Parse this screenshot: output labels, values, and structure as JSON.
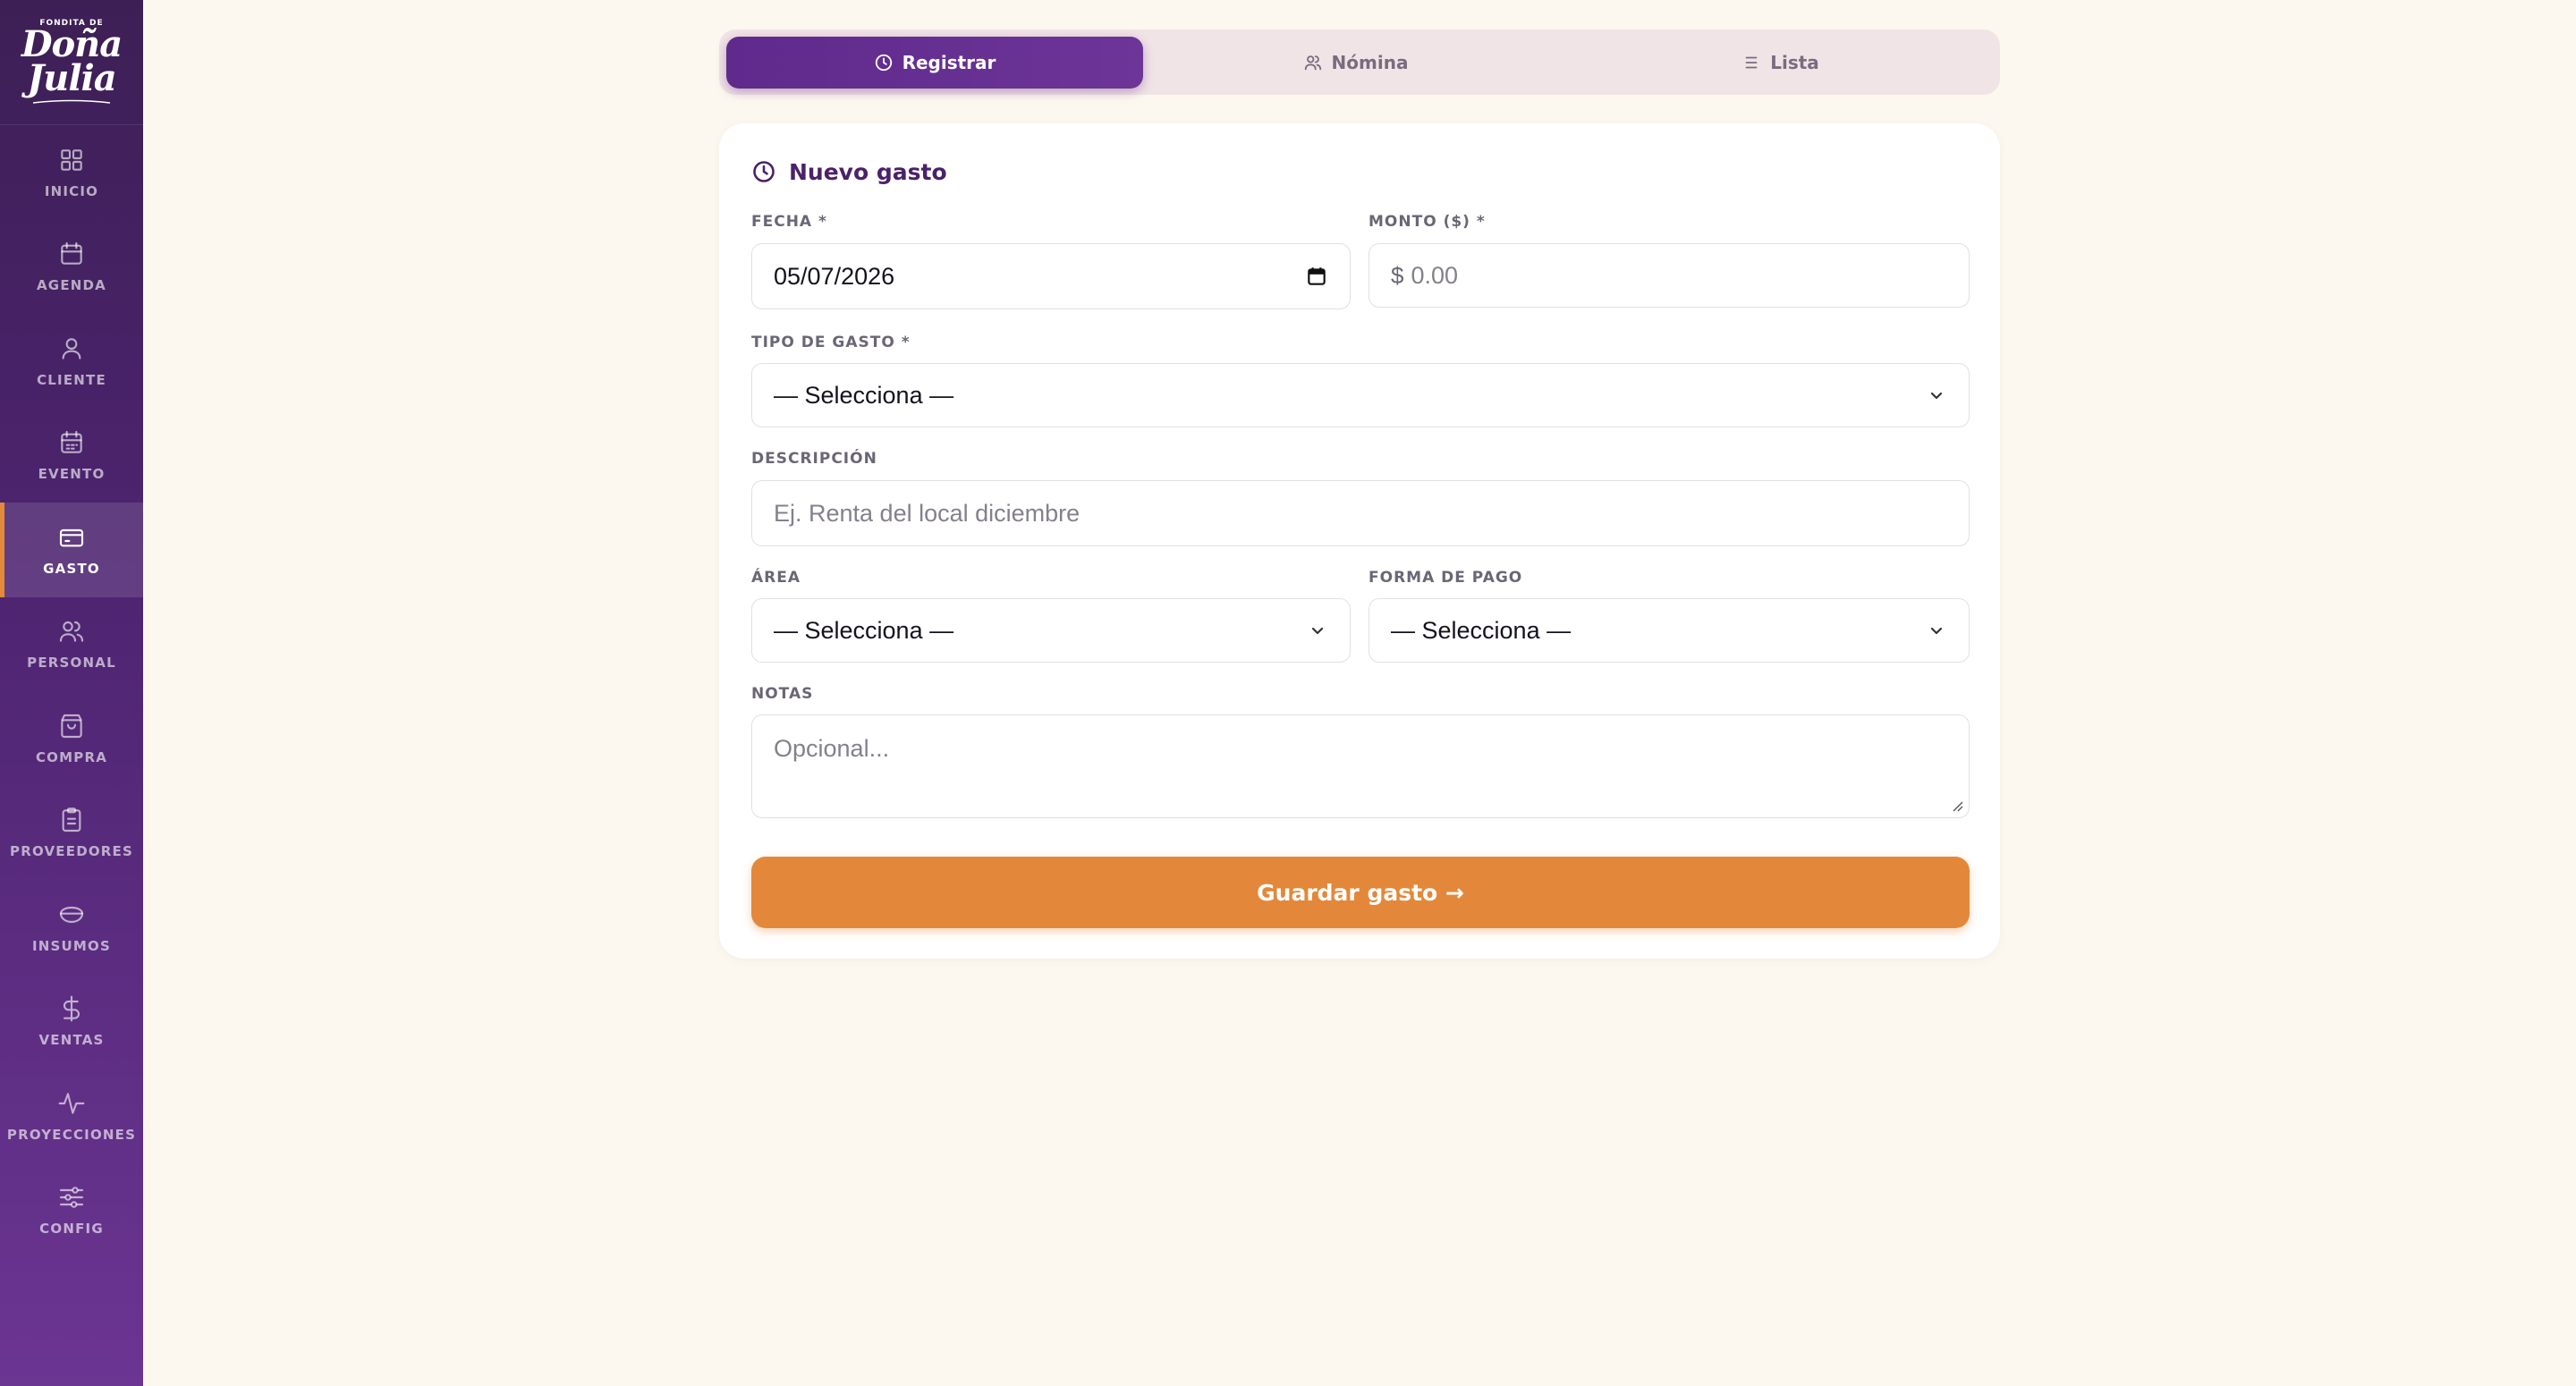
{
  "brand": {
    "small": "FONDITA DE",
    "line1": "Doña",
    "line2": "Julia"
  },
  "sidebar": {
    "items": [
      {
        "label": "INICIO",
        "icon": "grid-icon"
      },
      {
        "label": "AGENDA",
        "icon": "calendar-icon"
      },
      {
        "label": "CLIENTE",
        "icon": "user-icon"
      },
      {
        "label": "EVENTO",
        "icon": "calendar-event-icon"
      },
      {
        "label": "GASTO",
        "icon": "card-icon",
        "active": true
      },
      {
        "label": "PERSONAL",
        "icon": "users-icon"
      },
      {
        "label": "COMPRA",
        "icon": "shopping-bag-icon"
      },
      {
        "label": "PROVEEDORES",
        "icon": "clipboard-icon"
      },
      {
        "label": "INSUMOS",
        "icon": "bowl-icon"
      },
      {
        "label": "VENTAS",
        "icon": "dollar-icon"
      },
      {
        "label": "PROYECCIONES",
        "icon": "activity-icon"
      },
      {
        "label": "CONFIG",
        "icon": "sliders-icon"
      }
    ]
  },
  "tabs": [
    {
      "label": "Registrar",
      "icon": "clock-icon",
      "active": true
    },
    {
      "label": "Nómina",
      "icon": "users-icon"
    },
    {
      "label": "Lista",
      "icon": "list-icon"
    }
  ],
  "form": {
    "title": "Nuevo gasto",
    "fecha": {
      "label": "FECHA *",
      "value": "05/07/2026"
    },
    "monto": {
      "label": "MONTO ($) *",
      "prefix": "$",
      "placeholder": "0.00"
    },
    "tipo": {
      "label": "TIPO DE GASTO *",
      "value": "— Selecciona —"
    },
    "descripcion": {
      "label": "DESCRIPCIÓN",
      "placeholder": "Ej. Renta del local diciembre"
    },
    "area": {
      "label": "ÁREA",
      "value": "— Selecciona —"
    },
    "forma_pago": {
      "label": "FORMA DE PAGO",
      "value": "— Selecciona —"
    },
    "notas": {
      "label": "NOTAS",
      "placeholder": "Opcional..."
    },
    "save_label": "Guardar gasto →"
  },
  "colors": {
    "sidebar_top": "#3d1f55",
    "sidebar_bottom": "#6b3592",
    "accent_orange": "#e3883a",
    "accent_purple": "#5f2a8c",
    "page_bg": "#fdf8ef"
  }
}
